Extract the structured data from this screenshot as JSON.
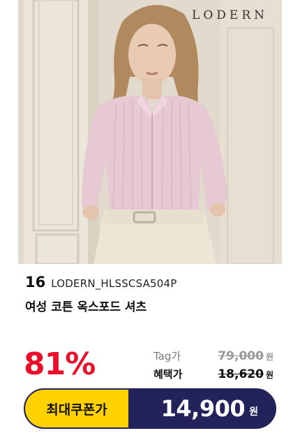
{
  "product": {
    "brand_logo": "LODERN",
    "rank": "16",
    "code": "LODERN_HLSSCSA504P",
    "name": "여성 코튼 옥스포드 셔츠",
    "discount": "81%",
    "tag_label": "Tag가",
    "tag_price": "79,000",
    "tag_unit": "원",
    "benefit_label": "혜택가",
    "benefit_price": "18,620",
    "benefit_unit": "원",
    "coupon_label": "최대쿠폰가",
    "coupon_price": "14,900",
    "coupon_unit": "원"
  },
  "colors": {
    "discount": "#e8102a",
    "coupon_bar": "#24225a",
    "coupon_label_bg": "#ffd200",
    "shirt": "#e6c9d3"
  },
  "icons": {
    "product_image": "woman-in-pink-striped-shirt-photo"
  }
}
